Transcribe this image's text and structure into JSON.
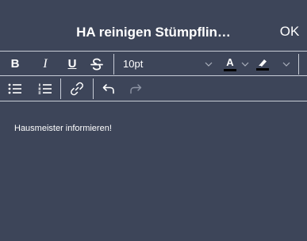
{
  "header": {
    "title": "HA reinigen Stümpflin…",
    "ok_label": "OK"
  },
  "toolbar": {
    "bold_label": "B",
    "italic_label": "I",
    "underline_label": "U",
    "font_size": "10pt",
    "font_color_label": "A",
    "font_color": "#000000",
    "highlight_color": "#000000"
  },
  "editor": {
    "text": "Hausmeister informieren!"
  }
}
